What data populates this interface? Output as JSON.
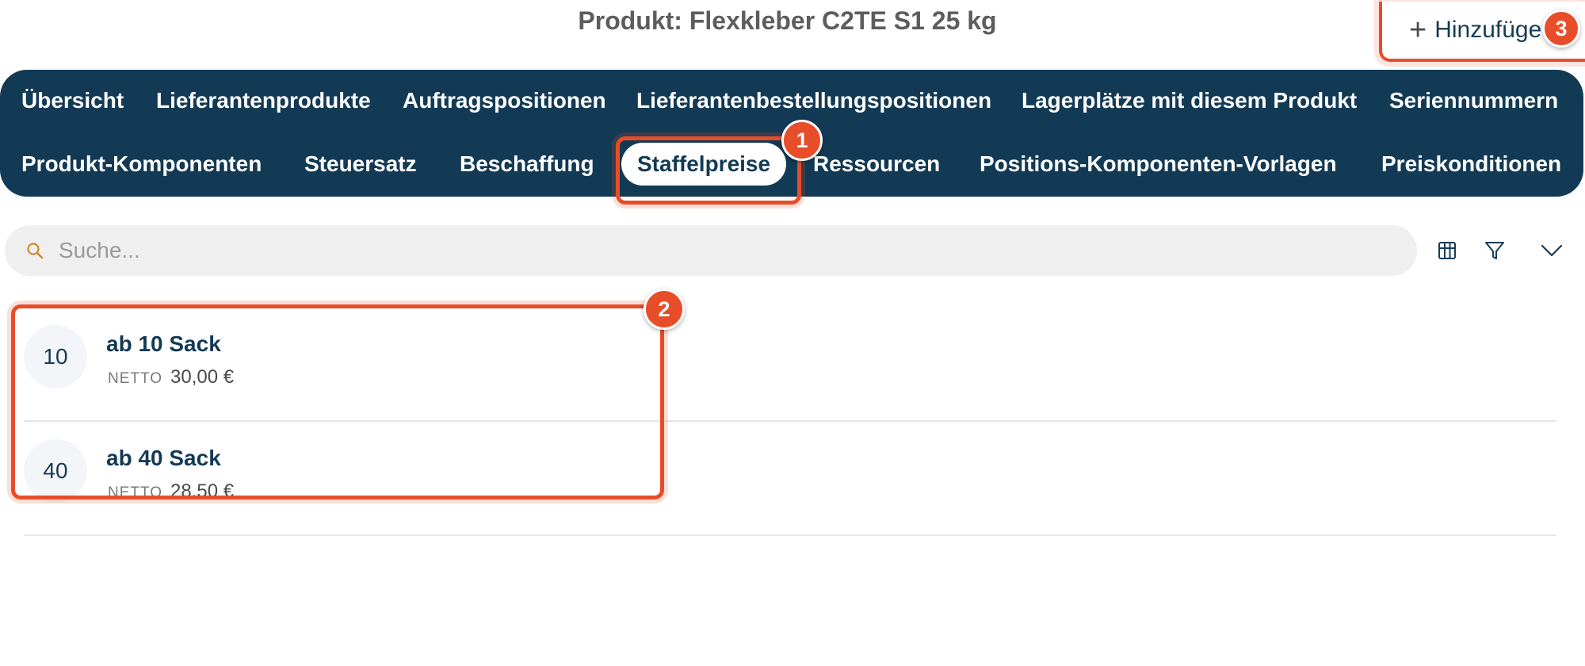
{
  "header": {
    "title": "Produkt: Flexkleber C2TE S1 25 kg",
    "add_label": "Hinzufüge",
    "add_icon": "plus-icon"
  },
  "tabs": {
    "row1": [
      "Übersicht",
      "Lieferantenprodukte",
      "Auftragspositionen",
      "Lieferantenbestellungspositionen",
      "Lagerplätze mit diesem Produkt",
      "Seriennummern"
    ],
    "row2": [
      "Produkt-Komponenten",
      "Steuersatz",
      "Beschaffung",
      "Staffelpreise",
      "Ressourcen",
      "Positions-Komponenten-Vorlagen",
      "Preiskonditionen"
    ],
    "active": "Staffelpreise"
  },
  "search": {
    "placeholder": "Suche...",
    "value": ""
  },
  "toolbar": {
    "icons": [
      "grid-icon",
      "filter-icon",
      "chevron-down-icon"
    ]
  },
  "items": [
    {
      "qty": "10",
      "title": "ab 10 Sack",
      "label": "NETTO",
      "price": "30,00 €"
    },
    {
      "qty": "40",
      "title": "ab 40 Sack",
      "label": "NETTO",
      "price": "28,50 €"
    }
  ],
  "markers": [
    "1",
    "2",
    "3"
  ],
  "colors": {
    "nav_bg": "#133a55",
    "accent": "#e84d2a",
    "text_dark": "#173c55"
  }
}
